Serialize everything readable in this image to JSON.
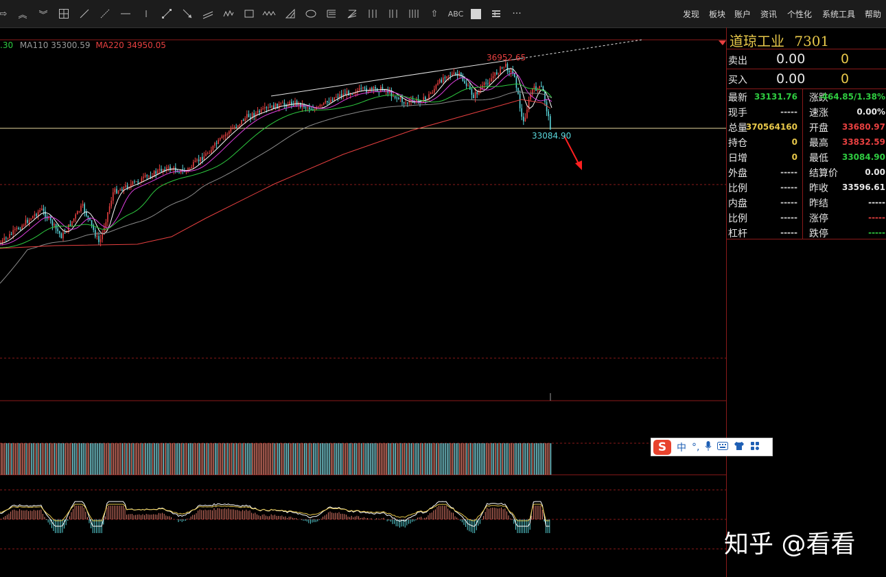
{
  "toolbar": {
    "tools": [
      "arrow-right-icon",
      "double-chevron-up-icon",
      "double-chevron-down-icon",
      "layout-grid-icon",
      "line-tool-icon",
      "ray-tool-icon",
      "horizontal-line-icon",
      "vertical-line-icon",
      "arrow-line-icon",
      "down-arrow-line-icon",
      "parallel-line-icon",
      "wave-tool-icon",
      "rectangle-tool-icon",
      "zigzag-tool-icon",
      "triangle-tool-icon",
      "ellipse-tool-icon",
      "fibonacci-tool-icon",
      "gann-fan-icon",
      "period-lines-icon",
      "fib-time-icon",
      "cycle-lines-icon",
      "up-arrow-icon",
      "text-tool-icon",
      "color-box-icon",
      "settings-icon",
      "more-icon"
    ],
    "text_tool_label": "ABC",
    "more_label": "···",
    "menu": [
      "发现",
      "板块",
      "账户",
      "资讯",
      "个性化",
      "系统工具",
      "帮助"
    ]
  },
  "chart": {
    "ma_legend": [
      {
        "text": ".30",
        "color": "#2ecc40"
      },
      {
        "text": "MA110",
        "color": "#9a9a9a"
      },
      {
        "text": "35300.59",
        "color": "#9a9a9a"
      },
      {
        "text": "MA220",
        "color": "#e84040"
      },
      {
        "text": "34950.05",
        "color": "#e84040"
      }
    ],
    "high_label": "36952.65",
    "low_label": "33084.90"
  },
  "panel": {
    "title": "道琼工业",
    "code": "7301",
    "sell_label": "卖出",
    "sell_price": "0.00",
    "sell_qty": "0",
    "buy_label": "买入",
    "buy_price": "0.00",
    "buy_qty": "0",
    "rows": [
      {
        "l1": "最新",
        "v1": "33131.76",
        "c1": "#2ecc40",
        "l2": "涨跌",
        "v2": "-464.85/1.38%",
        "c2": "#2ecc40"
      },
      {
        "l1": "现手",
        "v1": "-----",
        "c1": "#cfcfcf",
        "l2": "速涨",
        "v2": "0.00%",
        "c2": "#e6e6e6"
      },
      {
        "l1": "总量",
        "v1": "370564160",
        "c1": "#e8c84a",
        "l2": "开盘",
        "v2": "33680.97",
        "c2": "#e84040"
      },
      {
        "l1": "持仓",
        "v1": "0",
        "c1": "#e8c84a",
        "l2": "最高",
        "v2": "33832.59",
        "c2": "#e84040"
      },
      {
        "l1": "日增",
        "v1": "0",
        "c1": "#e8c84a",
        "l2": "最低",
        "v2": "33084.90",
        "c2": "#2ecc40"
      },
      {
        "l1": "外盘",
        "v1": "-----",
        "c1": "#cfcfcf",
        "l2": "结算价",
        "v2": "0.00",
        "c2": "#e6e6e6"
      },
      {
        "l1": "比例",
        "v1": "-----",
        "c1": "#cfcfcf",
        "l2": "昨收",
        "v2": "33596.61",
        "c2": "#e6e6e6"
      },
      {
        "l1": "内盘",
        "v1": "-----",
        "c1": "#cfcfcf",
        "l2": "昨结",
        "v2": "-----",
        "c2": "#e6e6e6"
      },
      {
        "l1": "比例",
        "v1": "-----",
        "c1": "#cfcfcf",
        "l2": "涨停",
        "v2": "-----",
        "c2": "#e84040"
      },
      {
        "l1": "杠杆",
        "v1": "-----",
        "c1": "#cfcfcf",
        "l2": "跌停",
        "v2": "-----",
        "c2": "#2ecc40"
      }
    ]
  },
  "ime": {
    "brand": "S",
    "items": [
      "中",
      "°,",
      "mic-icon",
      "keyboard-icon",
      "shirt-icon",
      "grid-icon"
    ]
  },
  "watermark": "知乎 @看看",
  "colors": {
    "up": "#e84040",
    "down": "#2ecc40",
    "cyan": "#5ad7dc",
    "accent": "#e8c84a",
    "frame": "#8b1a1a"
  }
}
